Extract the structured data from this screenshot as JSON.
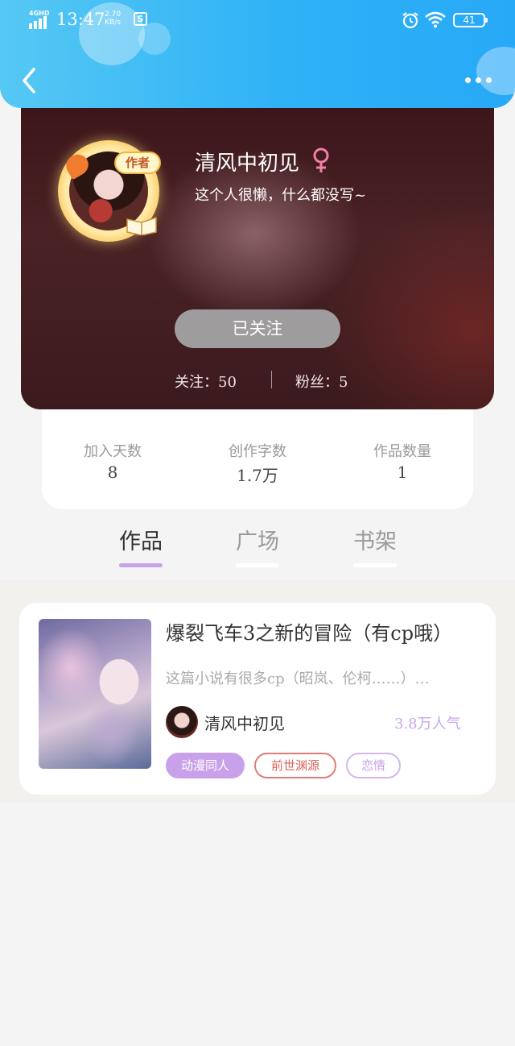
{
  "status_bar": {
    "network": "4GHD",
    "time": "13:47",
    "speed_value": "2.70",
    "speed_unit": "KB/s",
    "app_icon_letter": "S",
    "battery": "41"
  },
  "header": {
    "back_icon": "chevron-left-icon",
    "more_icon": "more-dots-icon",
    "accent_color": "#2fb2f6"
  },
  "profile": {
    "badge": "作者",
    "username": "清风中初见",
    "gender_symbol": "♀",
    "bio": "这个人很懒，什么都没写~",
    "follow_button": "已关注",
    "following_label": "关注：",
    "following_count": "50",
    "fans_label": "粉丝：",
    "fans_count": "5"
  },
  "stats": [
    {
      "label": "加入天数",
      "value": "8"
    },
    {
      "label": "创作字数",
      "value": "1.7万"
    },
    {
      "label": "作品数量",
      "value": "1"
    }
  ],
  "tabs": [
    {
      "label": "作品",
      "active": true
    },
    {
      "label": "广场",
      "active": false
    },
    {
      "label": "书架",
      "active": false
    }
  ],
  "works": [
    {
      "title": "爆裂飞车3之新的冒险（有cp哦）",
      "description": "这篇小说有很多cp（昭岚、伦柯……）…",
      "author": "清风中初见",
      "popularity": "3.8万人气",
      "tags": [
        "动漫同人",
        "前世渊源",
        "恋情"
      ]
    }
  ]
}
